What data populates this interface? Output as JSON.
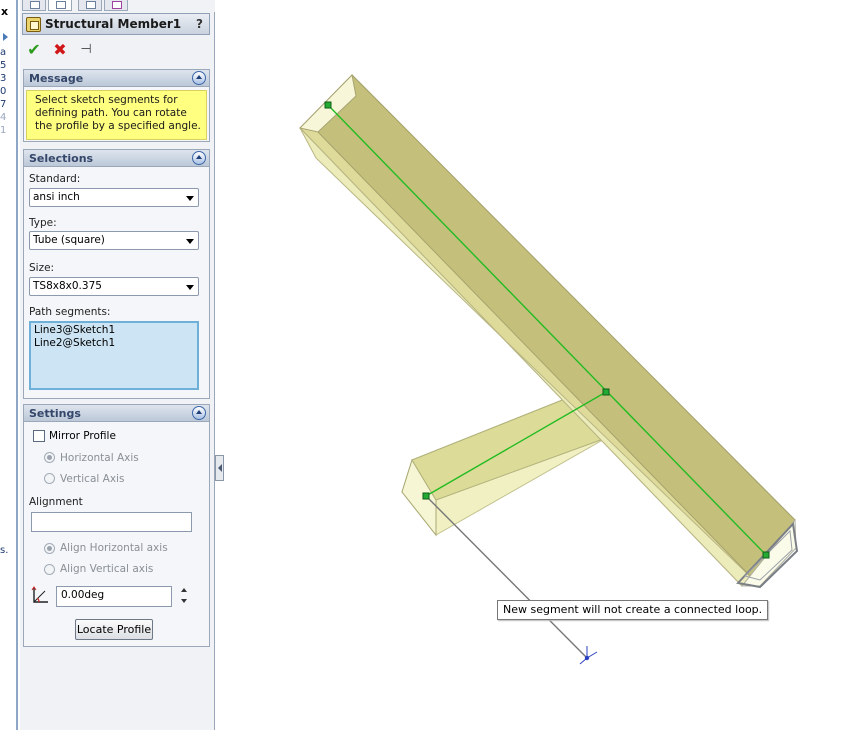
{
  "tree": {
    "close_glyph": "x",
    "letters": [
      "a",
      "5",
      "3",
      "0",
      "7",
      "4",
      "1"
    ],
    "side_label": "s."
  },
  "pm": {
    "title": "Structural Member1",
    "help_glyph": "?",
    "ok_glyph": "✔",
    "cancel_glyph": "✖",
    "pin_glyph": "⊣"
  },
  "message": {
    "title": "Message",
    "text": "Select sketch segments for defining path. You can rotate the profile by a specified angle."
  },
  "selections": {
    "title": "Selections",
    "standard_label": "Standard:",
    "standard_value": "ansi inch",
    "type_label": "Type:",
    "type_value": "Tube (square)",
    "size_label": "Size:",
    "size_value": "TS8x8x0.375",
    "path_label": "Path segments:",
    "path_items": [
      "Line3@Sketch1",
      "Line2@Sketch1"
    ]
  },
  "settings": {
    "title": "Settings",
    "mirror_label": "Mirror Profile",
    "horizontal_axis": "Horizontal Axis",
    "vertical_axis": "Vertical Axis",
    "alignment_label": "Alignment",
    "alignment_value": "",
    "align_horizontal": "Align Horizontal axis",
    "align_vertical": "Align Vertical axis",
    "angle_value": "0.00deg",
    "locate_label": "Locate Profile"
  },
  "viewport": {
    "tooltip": "New segment will not create a connected loop.",
    "member_fill": "#eeeeb0",
    "path_color": "#22bb22"
  }
}
